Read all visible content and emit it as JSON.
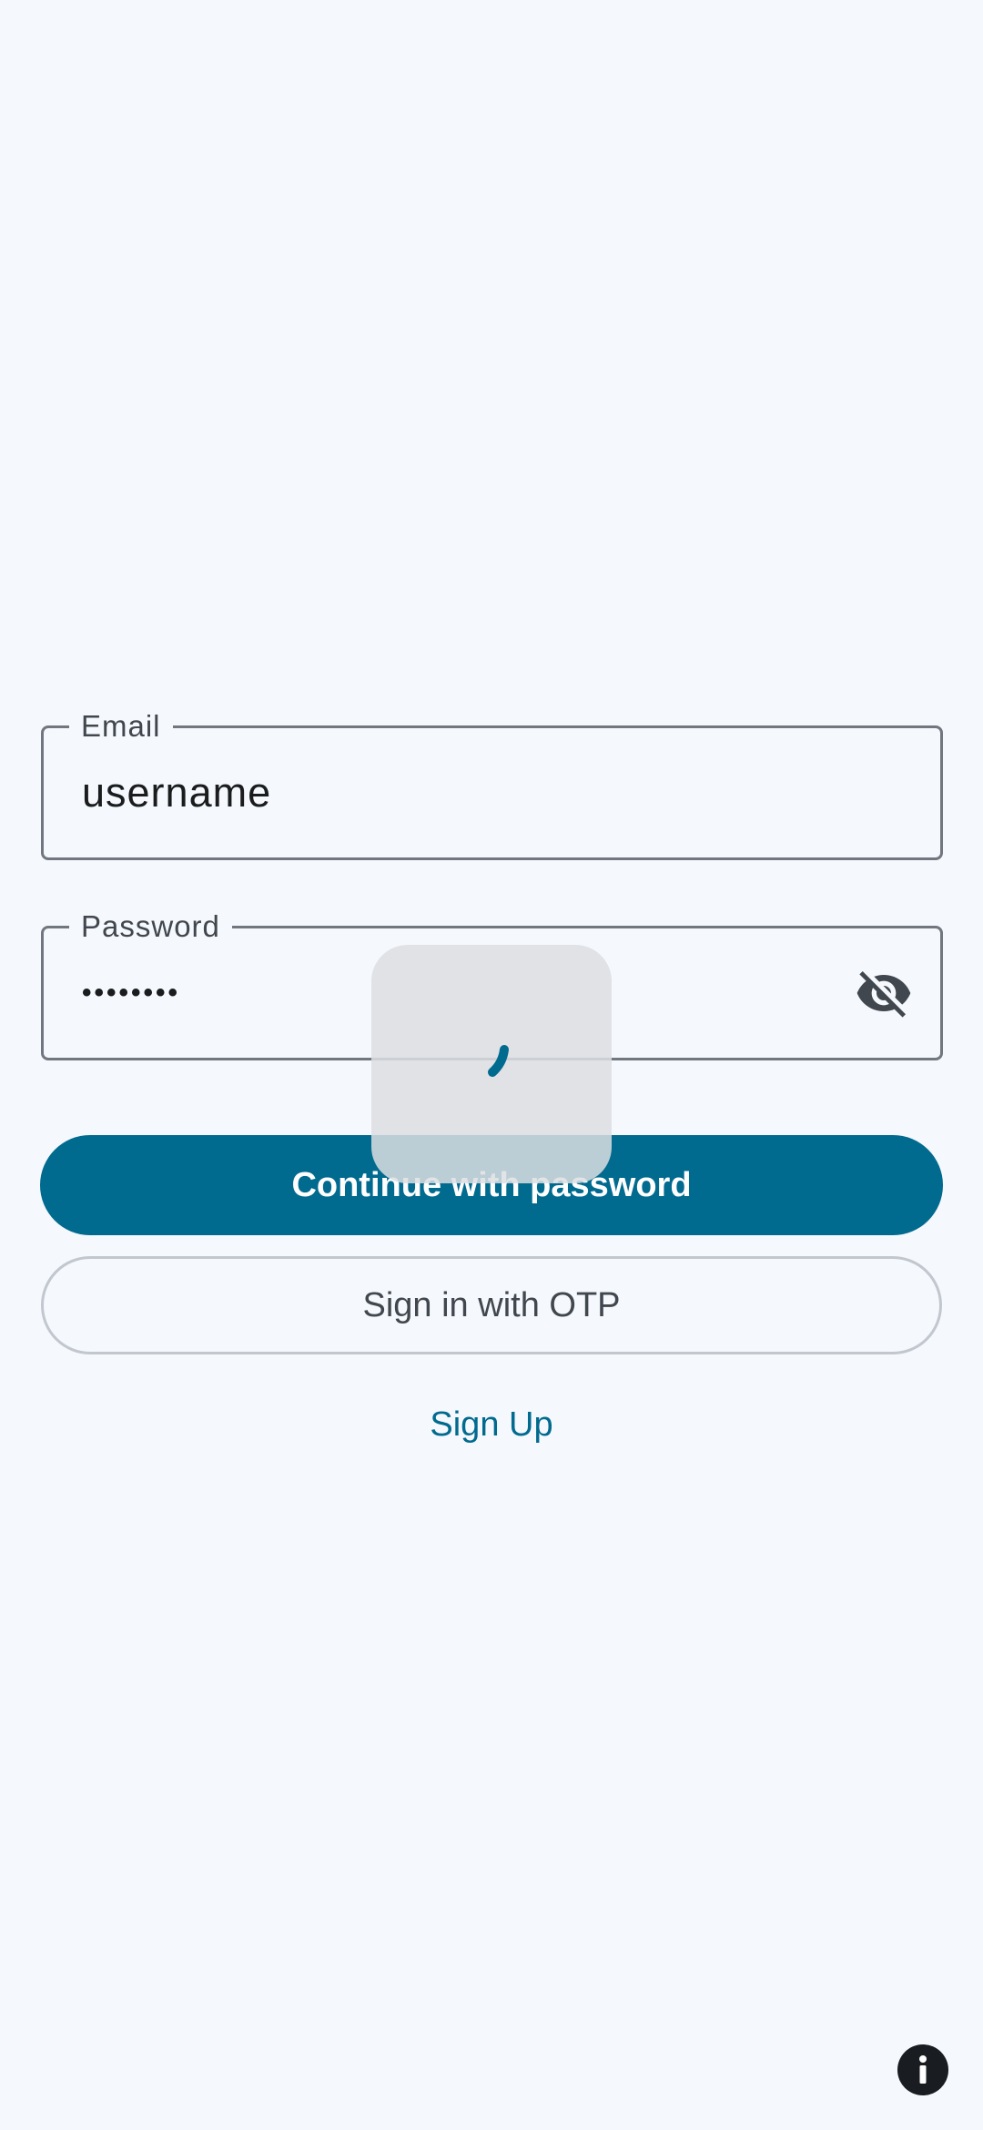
{
  "login_form": {
    "email": {
      "label": "Email",
      "value": "username"
    },
    "password": {
      "label": "Password",
      "value": "••••••••",
      "visibility_icon": "eye-off-icon"
    },
    "continue_button": "Continue with password",
    "otp_button": "Sign in with OTP",
    "signup_link": "Sign Up"
  },
  "loading": {
    "icon": "spinner-icon"
  },
  "info": {
    "icon": "info-icon"
  },
  "colors": {
    "background": "#f5f8fc",
    "primary": "#016a8f",
    "outline": "#72777f",
    "outline_variant": "#c2c7cf",
    "text": "#1a1c1e",
    "label_text": "#41474e"
  }
}
